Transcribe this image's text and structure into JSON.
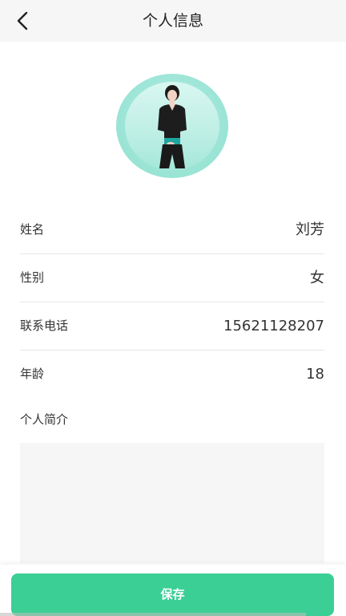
{
  "header": {
    "title": "个人信息",
    "back_icon": "chevron-left-icon"
  },
  "avatar": {
    "ring_color": "#9fe6d8"
  },
  "fields": [
    {
      "label": "姓名",
      "value": "刘芳"
    },
    {
      "label": "性别",
      "value": "女"
    },
    {
      "label": "联系电话",
      "value": "15621128207"
    },
    {
      "label": "年龄",
      "value": "18"
    }
  ],
  "intro": {
    "label": "个人简介",
    "value": ""
  },
  "footer": {
    "save_label": "保存",
    "accent_color": "#3bcf95"
  }
}
